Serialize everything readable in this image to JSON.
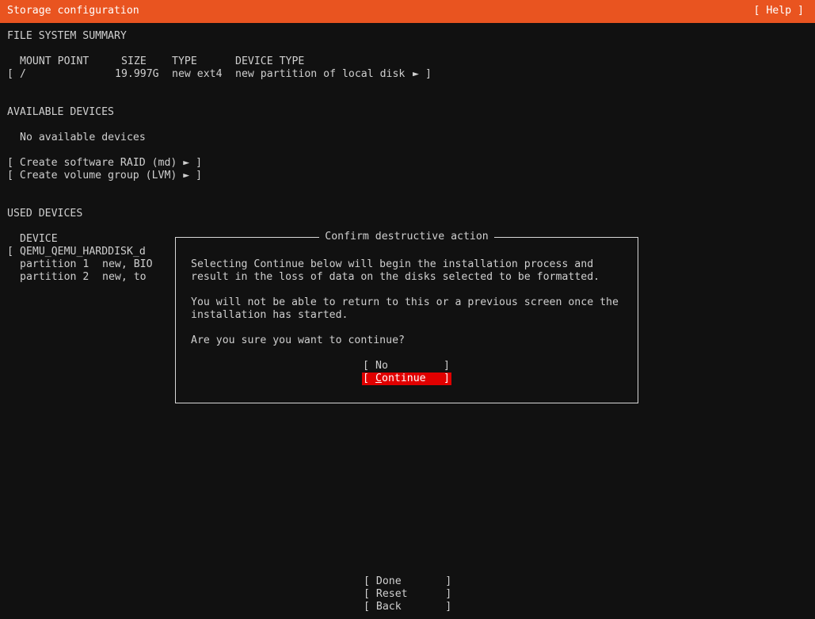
{
  "header": {
    "title": "Storage configuration",
    "help_label": "[ Help ]"
  },
  "fs_summary": {
    "heading": "FILE SYSTEM SUMMARY",
    "col_mount": "MOUNT POINT",
    "col_size": "SIZE",
    "col_type": "TYPE",
    "col_device_type": "DEVICE TYPE",
    "row": {
      "bracket_open": "[",
      "mount": "/",
      "size": "19.997G",
      "type": "new ext4",
      "device_type": "new partition of local disk",
      "arrow": "►",
      "bracket_close": "]"
    }
  },
  "available": {
    "heading": "AVAILABLE DEVICES",
    "empty": "No available devices",
    "create_raid": "[ Create software RAID (md) ► ]",
    "create_lvm": "[ Create volume group (LVM) ► ]"
  },
  "used": {
    "heading": "USED DEVICES",
    "col_device": "DEVICE",
    "disk_bracket": "[",
    "disk_name": "QEMU_QEMU_HARDDISK_d",
    "partitions": [
      {
        "label": "partition 1",
        "info": "new, BIO"
      },
      {
        "label": "partition 2",
        "info": "new, to"
      }
    ]
  },
  "dialog": {
    "title": "Confirm destructive action",
    "line1": "Selecting Continue below will begin the installation process and",
    "line2": "result in the loss of data on the disks selected to be formatted.",
    "line3": "You will not be able to return to this or a previous screen once the",
    "line4": "installation has started.",
    "question": "Are you sure you want to continue?",
    "no_button": {
      "open": "[ ",
      "label": "No",
      "close": "]"
    },
    "continue_button": {
      "open": "[ ",
      "first": "C",
      "rest": "ontinue",
      "close": "]"
    }
  },
  "footer": {
    "done": "[ Done       ]",
    "reset": "[ Reset      ]",
    "back": "[ Back       ]"
  },
  "colors": {
    "header_bg": "#e95420",
    "selected_bg": "#e00000",
    "background": "#111111",
    "text": "#cfcfcf"
  }
}
